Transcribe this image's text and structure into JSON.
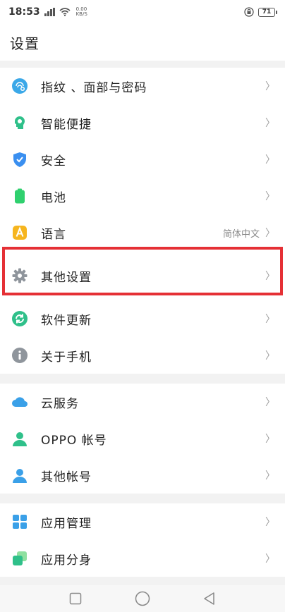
{
  "status": {
    "time": "18:53",
    "net_speed_value": "0.00",
    "net_speed_unit": "KB/S",
    "battery": "71"
  },
  "header": {
    "title": "设置"
  },
  "groups": [
    {
      "items": [
        {
          "label": "指纹 、面部与密码",
          "icon": "fingerprint-face-icon",
          "color": "#3ba8e8"
        },
        {
          "label": "智能便捷",
          "icon": "smart-head-icon",
          "color": "#2fc08a"
        },
        {
          "label": "安全",
          "icon": "shield-check-icon",
          "color": "#3a8ff0"
        },
        {
          "label": "电池",
          "icon": "battery-icon",
          "color": "#2fd06e"
        },
        {
          "label": "语言",
          "icon": "language-a-icon",
          "color": "#f6b51e",
          "value": "简体中文"
        },
        {
          "label": "其他设置",
          "icon": "gear-icon",
          "color": "#8f959c"
        },
        {
          "label": "软件更新",
          "icon": "update-icon",
          "color": "#2fc08a"
        },
        {
          "label": "关于手机",
          "icon": "info-icon",
          "color": "#8f959c"
        }
      ]
    },
    {
      "items": [
        {
          "label": "云服务",
          "icon": "cloud-icon",
          "color": "#3aa0e8"
        },
        {
          "label": "OPPO 帐号",
          "icon": "account-icon",
          "color": "#2fc08a"
        },
        {
          "label": "其他帐号",
          "icon": "other-account-icon",
          "color": "#3aa0e8"
        }
      ]
    },
    {
      "items": [
        {
          "label": "应用管理",
          "icon": "app-grid-icon",
          "color": "#3aa0e8"
        },
        {
          "label": "应用分身",
          "icon": "app-clone-icon",
          "color": "#2fc08a"
        }
      ]
    }
  ],
  "colors": {
    "highlight": "#e53035"
  }
}
